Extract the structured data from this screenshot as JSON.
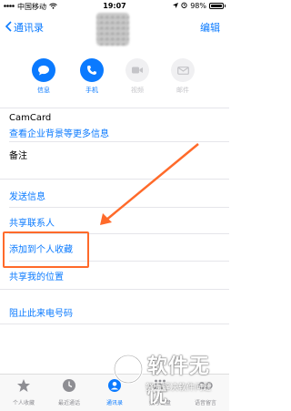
{
  "status_bar": {
    "carrier": "中国移动",
    "time": "19:07",
    "battery_text": "98%",
    "battery_level": 0.98
  },
  "nav": {
    "back_label": "通讯录",
    "edit_label": "编辑"
  },
  "actions": [
    {
      "label": "信息",
      "icon": "message-icon",
      "enabled": true
    },
    {
      "label": "手机",
      "icon": "phone-icon",
      "enabled": true
    },
    {
      "label": "视频",
      "icon": "video-icon",
      "enabled": false
    },
    {
      "label": "邮件",
      "icon": "mail-icon",
      "enabled": false
    }
  ],
  "fields": {
    "camcard_title": "CamCard",
    "camcard_link": "查看企业背景等更多信息",
    "notes_label": "备注"
  },
  "links": {
    "send_message": "发送信息",
    "share_contact": "共享联系人",
    "add_favorites": "添加到个人收藏",
    "share_location": "共享我的位置",
    "block_caller": "阻止此来电号码"
  },
  "tab_bar": {
    "items": [
      {
        "label": "个人收藏",
        "icon": "star-icon",
        "selected": false
      },
      {
        "label": "最近通话",
        "icon": "clock-icon",
        "selected": false
      },
      {
        "label": "通讯录",
        "icon": "contacts-icon",
        "selected": true
      },
      {
        "label": "拨号键盘",
        "icon": "keypad-icon",
        "selected": false
      },
      {
        "label": "语音留言",
        "icon": "voicemail-icon",
        "selected": false
      }
    ]
  },
  "watermark": {
    "title": "软件无忧",
    "subtitle": "努力解决软件问题"
  },
  "colors": {
    "accent": "#0a7aff",
    "annotation": "#ff6a2a"
  }
}
